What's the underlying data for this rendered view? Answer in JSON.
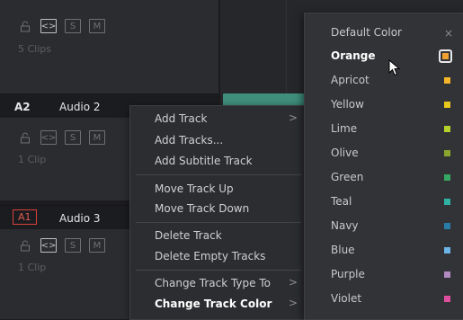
{
  "tracks": [
    {
      "id": "",
      "name": "",
      "clips": "5 Clips"
    },
    {
      "id": "A2",
      "name": "Audio 2",
      "clips": "1 Clip"
    },
    {
      "id": "A1",
      "name": "Audio 3",
      "clips": "1 Clip"
    }
  ],
  "track_buttons": {
    "lock": "",
    "auto": "<>",
    "solo": "S",
    "mute": "M"
  },
  "context_menu": {
    "add_track": "Add Track",
    "add_tracks": "Add Tracks...",
    "add_subtitle_track": "Add Subtitle Track",
    "move_up": "Move Track Up",
    "move_down": "Move Track Down",
    "delete_track": "Delete Track",
    "delete_empty": "Delete Empty Tracks",
    "change_type": "Change Track Type To",
    "change_color": "Change Track Color"
  },
  "color_menu": {
    "header": "Default Color",
    "close": "×",
    "items": [
      {
        "label": "Orange",
        "color": "#f0a030"
      },
      {
        "label": "Apricot",
        "color": "#f5b72a"
      },
      {
        "label": "Yellow",
        "color": "#e8c81e"
      },
      {
        "label": "Lime",
        "color": "#b6d22a"
      },
      {
        "label": "Olive",
        "color": "#8aa62d"
      },
      {
        "label": "Green",
        "color": "#35a862"
      },
      {
        "label": "Teal",
        "color": "#2fb2a4"
      },
      {
        "label": "Navy",
        "color": "#2a7ca8"
      },
      {
        "label": "Blue",
        "color": "#6db4e6"
      },
      {
        "label": "Purple",
        "color": "#b28ac0"
      },
      {
        "label": "Violet",
        "color": "#e04ea0"
      }
    ]
  }
}
